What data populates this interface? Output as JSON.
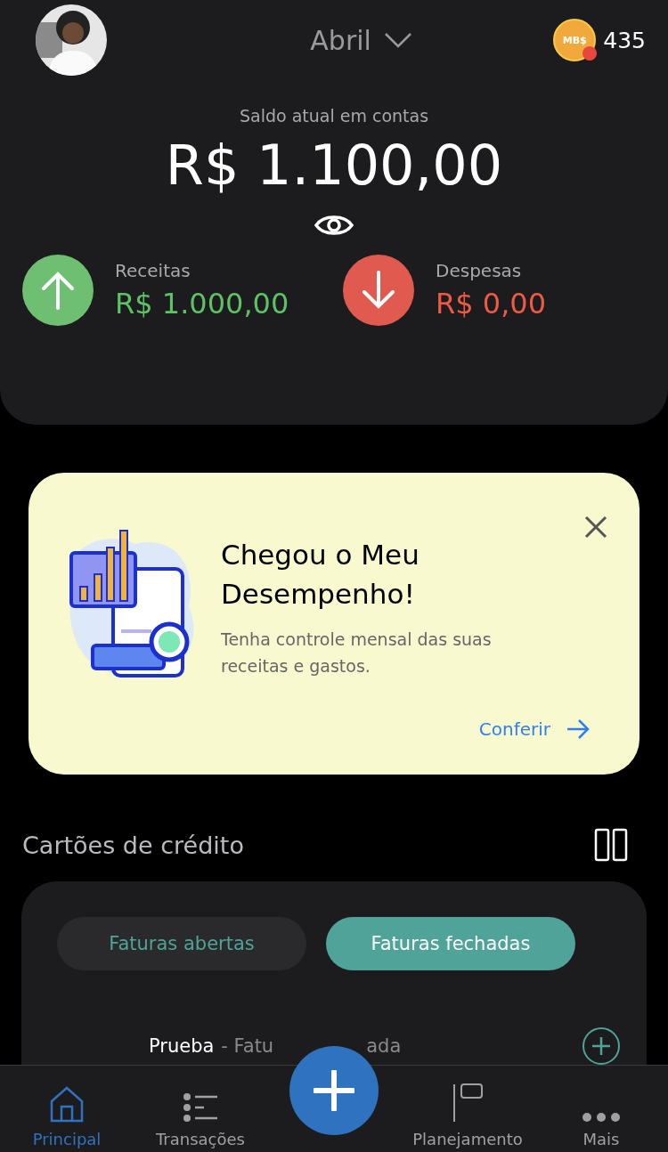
{
  "header": {
    "month": "Abril",
    "coins": "435",
    "coin_label": "MB$",
    "coin_alert": true,
    "balance_label": "Saldo atual em contas",
    "balance": "R$ 1.100,00"
  },
  "summary": [
    {
      "kind": "income",
      "label": "Receitas",
      "value": "R$ 1.000,00"
    },
    {
      "kind": "expense",
      "label": "Despesas",
      "value": "R$ 0,00"
    }
  ],
  "banner": {
    "title": "Chegou o Meu Desempenho!",
    "text": "Tenha controle mensal das suas receitas e gastos.",
    "link": "Conferir"
  },
  "cards_section": {
    "title": "Cartões de crédito",
    "tabs": [
      {
        "label": "Faturas abertas",
        "selected": false
      },
      {
        "label": "Faturas fechadas",
        "selected": true
      }
    ],
    "row": {
      "name": "Prueba",
      "status_start": "- Fatu",
      "status_end": "ada"
    }
  },
  "nav": [
    {
      "kind": "home",
      "label": "Principal",
      "selected": true
    },
    {
      "kind": "list",
      "label": "Transações",
      "selected": false
    },
    {
      "kind": "add"
    },
    {
      "kind": "flag",
      "label": "Planejamento",
      "selected": false
    },
    {
      "kind": "more",
      "label": "Mais",
      "selected": false
    }
  ]
}
